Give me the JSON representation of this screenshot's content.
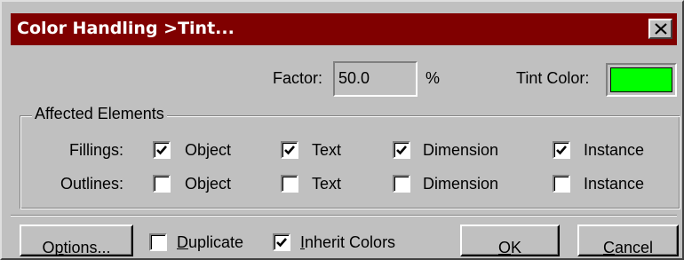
{
  "dialog": {
    "title": "Color Handling >Tint...",
    "close_glyph": "✕"
  },
  "factor": {
    "label": "Factor:",
    "value": "50.0",
    "unit": "%"
  },
  "tint": {
    "label": "Tint Color:",
    "color": "#00ff00"
  },
  "affected": {
    "legend": "Affected Elements",
    "fillings": {
      "label": "Fillings:",
      "items": [
        {
          "label": "Object",
          "checked": true
        },
        {
          "label": "Text",
          "checked": true
        },
        {
          "label": "Dimension",
          "checked": true
        },
        {
          "label": "Instance",
          "checked": true
        }
      ]
    },
    "outlines": {
      "label": "Outlines:",
      "items": [
        {
          "label": "Object",
          "checked": false
        },
        {
          "label": "Text",
          "checked": false
        },
        {
          "label": "Dimension",
          "checked": false
        },
        {
          "label": "Instance",
          "checked": false
        }
      ]
    }
  },
  "footer": {
    "options_pre": "O",
    "options_ul": "p",
    "options_post": "tions...",
    "duplicate_ul": "D",
    "duplicate_post": "uplicate",
    "duplicate_checked": false,
    "inherit_ul": "I",
    "inherit_post": "nherit Colors",
    "inherit_checked": true,
    "ok_ul": "O",
    "ok_post": "K",
    "cancel_ul": "C",
    "cancel_post": "ancel"
  },
  "colors": {
    "titlebar": "#800000",
    "face": "#c0c0c0"
  }
}
